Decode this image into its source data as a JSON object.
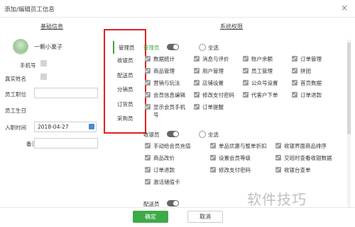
{
  "dialog": {
    "title": "添加/编辑员工信息",
    "close": "×"
  },
  "sections": {
    "basic": "基础信息",
    "perms": "系统权限"
  },
  "employee": {
    "nickname": "一颗小栗子",
    "phone_label": "手机号",
    "real_name_label": "真实姓名",
    "position_label": "员工职位",
    "birthday_label": "员工生日",
    "entry_label": "入职时间",
    "entry_value": "2018-04-27",
    "note_label": "备注"
  },
  "roles": [
    {
      "label": "管理员",
      "active": true
    },
    {
      "label": "收银员",
      "active": false
    },
    {
      "label": "配送员",
      "active": false
    },
    {
      "label": "分销员",
      "active": false
    },
    {
      "label": "订货员",
      "active": false
    },
    {
      "label": "采购员",
      "active": false
    }
  ],
  "admin": {
    "title": "管理员",
    "select_all": "全选",
    "perms": [
      [
        "数据统计",
        "消息与评价",
        "账户余额",
        "订单管理"
      ],
      [
        "商品管理",
        "用户管理",
        "员工管理",
        "拼团"
      ],
      [
        "营销与玩法",
        "店铺设置",
        "公众号设置",
        "首页数据"
      ],
      [
        "会员信息编辑",
        "修改支付密码",
        "代客户下单",
        "订单退款"
      ],
      [
        "显示会员手机",
        "订单提醒"
      ],
      [
        "号"
      ]
    ]
  },
  "cashier": {
    "title": "收银员",
    "select_all": "全选",
    "perms": [
      [
        "手动给会员充值",
        "单品优惠与整单折扣",
        "收银界面商品排序"
      ],
      [
        "商品改价",
        "设置会员等级",
        "交班时查看收银数据"
      ],
      [
        "订单退款",
        "修改支付密码",
        "收银台查单"
      ],
      [
        "激活储值卡"
      ]
    ]
  },
  "delivery": {
    "title": "配送员"
  },
  "footer": {
    "ok": "确定",
    "cancel": "取消"
  },
  "watermark": "软件技巧",
  "colors": {
    "accent": "#3daa47",
    "highlight": "#e02020"
  }
}
